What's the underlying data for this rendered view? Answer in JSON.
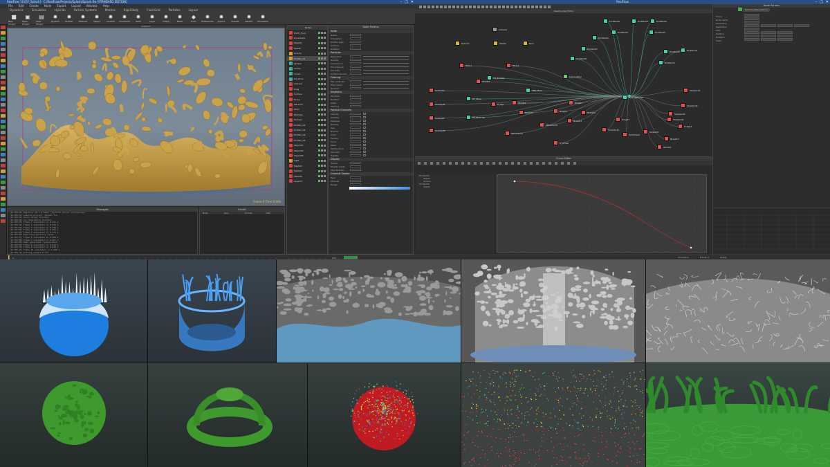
{
  "window": {
    "left_title": "RealFlow 10  [RF_Splash]  -  C:/RealFlow/Projects/Splash/Splash.flw  [STANDARD EDITION]",
    "right_title": "RealFlow",
    "controls": [
      "–",
      "□",
      "✕"
    ]
  },
  "menu": [
    "File",
    "Edit",
    "Create",
    "Node",
    "Export",
    "Layout",
    "Window",
    "Help"
  ],
  "tabs": [
    "Dynamics",
    "Simulation",
    "Hybrido",
    "Particle Systems",
    "Meshes",
    "Rigid Body",
    "Fluid Grid",
    "Particles",
    "Layout"
  ],
  "toolbar": [
    {
      "icon": "■",
      "label": "New Project"
    },
    {
      "icon": "▣",
      "label": "Open Project"
    },
    {
      "icon": "▤",
      "label": "Save Project"
    },
    {
      "icon": "✹",
      "label": "Dyverso"
    },
    {
      "icon": "✹",
      "label": "Emitter"
    },
    {
      "icon": "✹",
      "label": "Daemon"
    },
    {
      "icon": "✹",
      "label": "Object"
    },
    {
      "icon": "✹",
      "label": "Camera"
    },
    {
      "icon": "✹",
      "label": "Constraint"
    },
    {
      "icon": "✹",
      "label": "Mesh"
    },
    {
      "icon": "✹",
      "label": "Layer"
    },
    {
      "icon": "✹",
      "label": "Graph"
    },
    {
      "icon": "✹",
      "label": "Batch"
    },
    {
      "icon": "◆",
      "label": "Color"
    },
    {
      "icon": "✹",
      "label": "Preferences"
    },
    {
      "icon": "✹",
      "label": "Export"
    },
    {
      "icon": "✹",
      "label": "Presets"
    },
    {
      "icon": "✹",
      "label": "Render"
    },
    {
      "icon": "✹",
      "label": "Simulation"
    }
  ],
  "viewport": {
    "title": "Viewport",
    "frame_label": "Frame 0   Time 0.000"
  },
  "console": {
    "title": "Messages",
    "lines": [
      "[12:00:01] RealFlow 10.1.0.0162 — Dyverso Solver initialized",
      "[12:00:01] Loading project: Splash.flw",
      "[12:00:02] Scene setup finished.",
      "[12:00:02] >>> Simulation started.",
      "[12:00:03] Frame 1 simulated in 0.521 s",
      "[12:00:04] Frame 2 simulated in 0.533 s",
      "[12:00:04] Frame 3 simulated in 0.548 s",
      "[12:00:05] Frame 4 simulated in 0.562 s",
      "[12:00:06] Frame 5 simulated in 0.574 s",
      "[12:00:06] Exporting particle cache...",
      "[12:00:07] Frame 6 simulated in 0.589 s",
      "[12:00:08] Frame 7 simulated in 0.601 s",
      "[12:00:08] Mesh generated: Splash_Mesh",
      "[12:00:09] Frame 8 simulated in 0.612 s",
      "[12:00:10] Frame 9 simulated in 0.628 s",
      "[12:00:10] Frame 10 simulated in 0.640 s",
      "[12:00:11] Writing output files...",
      "[12:00:12] Frame 11 simulated in 0.655 s"
    ]
  },
  "exporter": {
    "title": "Export",
    "rows": [
      "Node",
      "Type",
      "Format",
      "Path"
    ]
  },
  "nodes_panel": {
    "title": "Nodes",
    "items": [
      {
        "name": "DSPH_Fluid",
        "color": "#e04040"
      },
      {
        "name": "Dyverso01",
        "color": "#e04040"
      },
      {
        "name": "Mesh01",
        "color": "#e04040"
      },
      {
        "name": "Splash",
        "color": "#e04040"
      },
      {
        "name": "Gravity",
        "color": "#e0a030"
      },
      {
        "name": "Emitter_01",
        "color": "#d0a040"
      },
      {
        "name": "Sphere",
        "color": "#40b0a0"
      },
      {
        "name": "Vortex",
        "color": "#40b0a0"
      },
      {
        "name": "Crown",
        "color": "#40b0a0"
      },
      {
        "name": "Kill_Zone",
        "color": "#40b0a0"
      },
      {
        "name": "Camera",
        "color": "#e04040"
      },
      {
        "name": "Drag",
        "color": "#e04040"
      },
      {
        "name": "Surface",
        "color": "#e04040"
      },
      {
        "name": "Noise",
        "color": "#e04040"
      },
      {
        "name": "Attractor",
        "color": "#e04040"
      },
      {
        "name": "Wind",
        "color": "#e04040"
      },
      {
        "name": "Particles",
        "color": "#e04040"
      },
      {
        "name": "Domain",
        "color": "#e04040"
      },
      {
        "name": "Emitter_02",
        "color": "#e04040"
      },
      {
        "name": "Emitter_03",
        "color": "#e04040"
      },
      {
        "name": "Emitter_04",
        "color": "#e04040"
      },
      {
        "name": "Emitter_05",
        "color": "#e04040"
      },
      {
        "name": "Object01",
        "color": "#e04040"
      },
      {
        "name": "Object02",
        "color": "#e04040"
      },
      {
        "name": "Object03",
        "color": "#e04040"
      },
      {
        "name": "Light",
        "color": "#e0a030"
      },
      {
        "name": "Mesh02",
        "color": "#e04040"
      },
      {
        "name": "Mesh03",
        "color": "#e04040"
      },
      {
        "name": "Mesh04",
        "color": "#e04040"
      },
      {
        "name": "Layer01",
        "color": "#e04040"
      }
    ]
  },
  "params": {
    "title": "Node Params",
    "sections": [
      {
        "name": "Node",
        "rows": [
          "Name",
          "Simulation",
          "Emitter type",
          "Position",
          "Rotation"
        ]
      },
      {
        "name": "Particles",
        "rows": [
          "Resolution",
          "Density",
          "Int pressure",
          "Ext pressure",
          "Viscosity",
          "Surface tension"
        ]
      },
      {
        "name": "Filtering",
        "rows": [
          "Max particles",
          "Filter factor",
          "Random"
        ]
      },
      {
        "name": "Statistics",
        "rows": [
          "Particles",
          "Emitted",
          "Killed",
          "Memory"
        ]
      },
      {
        "name": "Particle Channels",
        "rows": [
          "Velocity",
          "Vorticity",
          "Pressure",
          "Density",
          "Age",
          "Normal",
          "Color",
          "Texture",
          "Force",
          "Mass",
          "Temperature",
          "Viscosity",
          "Rigidity"
        ]
      },
      {
        "name": "Display",
        "rows": [
          "Visible",
          "Display mode",
          "Max Particles"
        ]
      },
      {
        "name": "Channel Shader",
        "rows": [
          "Type",
          "Channel",
          "Range"
        ]
      }
    ]
  },
  "timeline": {
    "frame": "0",
    "end": "250"
  },
  "relationship_editor": {
    "title": "Relationship Editor",
    "nodes": [
      {
        "name": "Camera",
        "color": "#9a9a9a"
      },
      {
        "name": "Hybrido",
        "color": "#e0b040"
      },
      {
        "name": "Master",
        "color": "#e0b040"
      },
      {
        "name": "Rain",
        "color": "#e0b040"
      },
      {
        "name": "Filter1",
        "color": "#e05050"
      },
      {
        "name": "Filter2",
        "color": "#e05050"
      },
      {
        "name": "FIll_Emitter",
        "color": "#40d0b0"
      },
      {
        "name": "Liquid_Base",
        "color": "#60d060"
      },
      {
        "name": "Vortex01",
        "color": "#e05050"
      },
      {
        "name": "Vortex02",
        "color": "#e05050"
      },
      {
        "name": "HF_Base",
        "color": "#40d0b0"
      },
      {
        "name": "HF_Particles",
        "color": "#40d0b0"
      },
      {
        "name": "Emitter01",
        "color": "#40d0b0"
      },
      {
        "name": "Emitter02",
        "color": "#40d0b0"
      },
      {
        "name": "Emitter03",
        "color": "#40d0b0"
      },
      {
        "name": "Emitter04",
        "color": "#40d0b0"
      },
      {
        "name": "Emitter05",
        "color": "#40d0b0"
      },
      {
        "name": "Emitter06",
        "color": "#40d0b0"
      },
      {
        "name": "Emitter07",
        "color": "#40d0b0"
      },
      {
        "name": "Emitter08",
        "color": "#40d0b0"
      },
      {
        "name": "Emitter09",
        "color": "#40d0b0"
      },
      {
        "name": "Emitter10",
        "color": "#40d0b0"
      },
      {
        "name": "Emitter11",
        "color": "#40d0b0"
      },
      {
        "name": "FBO_Base",
        "color": "#40d0b0"
      },
      {
        "name": "Wind01",
        "color": "#e05050"
      },
      {
        "name": "Noise01",
        "color": "#e05050"
      },
      {
        "name": "Attractor01",
        "color": "#e05050"
      },
      {
        "name": "Gravity01",
        "color": "#e05050"
      },
      {
        "name": "Gravity02",
        "color": "#e05050"
      },
      {
        "name": "Drag01",
        "color": "#e05050"
      },
      {
        "name": "Drag02",
        "color": "#e05050"
      },
      {
        "name": "Sheeter01",
        "color": "#e05050"
      },
      {
        "name": "Sheeter02",
        "color": "#e05050"
      },
      {
        "name": "Noise02",
        "color": "#e05050"
      },
      {
        "name": "Noise03",
        "color": "#e05050"
      },
      {
        "name": "Attractor02",
        "color": "#e05050"
      },
      {
        "name": "S_Vortex",
        "color": "#e05050"
      },
      {
        "name": "Vorticity01",
        "color": "#e05050"
      },
      {
        "name": "Vorticity02",
        "color": "#e05050"
      },
      {
        "name": "Vortex03",
        "color": "#e05050"
      },
      {
        "name": "Drag03",
        "color": "#e05050"
      },
      {
        "name": "K_Age",
        "color": "#e05050"
      },
      {
        "name": "Wind02",
        "color": "#e05050"
      },
      {
        "name": "Hybr_Particles",
        "color": "#40d0b0"
      },
      {
        "name": "Sheeter03",
        "color": "#e05050"
      },
      {
        "name": "Drag04",
        "color": "#e05050"
      },
      {
        "name": "Noise04",
        "color": "#e05050"
      },
      {
        "name": "Wind03",
        "color": "#e05050"
      },
      {
        "name": "Sheeter04",
        "color": "#e05050"
      }
    ]
  },
  "curve_editor": {
    "title": "Curve Editor",
    "tree": [
      "Emitter01",
      "Speed",
      "Volume",
      "Emitter02",
      "Speed"
    ]
  },
  "properties": {
    "title": "Node Params",
    "node_name": "Hybrido_Main_Volume",
    "rows": [
      "Scene",
      "Node name",
      "Simulation",
      "Resolution",
      "Size",
      "Position",
      "Rotation",
      "Scale"
    ]
  },
  "status": {
    "left": "Simulation",
    "mid": "Frame: 0",
    "right": "Ready"
  },
  "gallery": [
    {
      "id": "blue-crown"
    },
    {
      "id": "blue-transparent"
    },
    {
      "id": "grey-blue-splash"
    },
    {
      "id": "grey-column"
    },
    {
      "id": "grey-wireframe"
    },
    {
      "id": "green-sphere"
    },
    {
      "id": "green-ring"
    },
    {
      "id": "rgb-particles"
    },
    {
      "id": "rgb-dots"
    },
    {
      "id": "green-surface"
    }
  ]
}
